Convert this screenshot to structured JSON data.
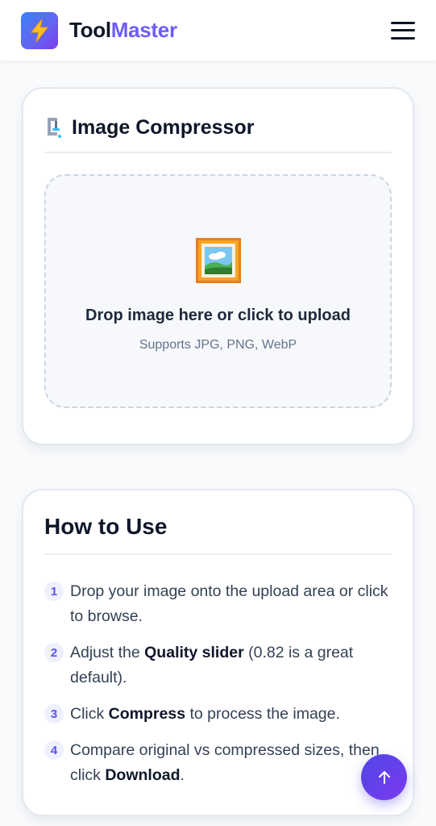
{
  "header": {
    "brand_part1": "Tool",
    "brand_part2": "Master",
    "logo_icon": "lightning-bolt-icon",
    "menu_icon": "hamburger-menu-icon"
  },
  "tool_card": {
    "title_icon": "clamp-icon",
    "title": "Image Compressor",
    "upload": {
      "icon": "framed-picture-icon",
      "primary_text": "Drop image here or click to upload",
      "secondary_text": "Supports JPG, PNG, WebP"
    }
  },
  "howto_card": {
    "title": "How to Use",
    "steps": [
      {
        "number": "1",
        "text_before": "Drop your image onto the upload area or click to browse.",
        "bold": "",
        "text_after": ""
      },
      {
        "number": "2",
        "text_before": "Adjust the ",
        "bold": "Quality slider",
        "text_after": " (0.82 is a great default)."
      },
      {
        "number": "3",
        "text_before": "Click ",
        "bold": "Compress",
        "text_after": " to process the image."
      },
      {
        "number": "4",
        "text_before": "Compare original vs compressed sizes, then click ",
        "bold": "Download",
        "text_after": "."
      }
    ]
  },
  "scroll_top_button": {
    "icon": "arrow-up-icon"
  },
  "colors": {
    "brand_accent": "#6d5dfc",
    "fab_gradient_start": "#4f46e5",
    "fab_gradient_end": "#7c3aed",
    "step_number": "#5b4ff0"
  }
}
